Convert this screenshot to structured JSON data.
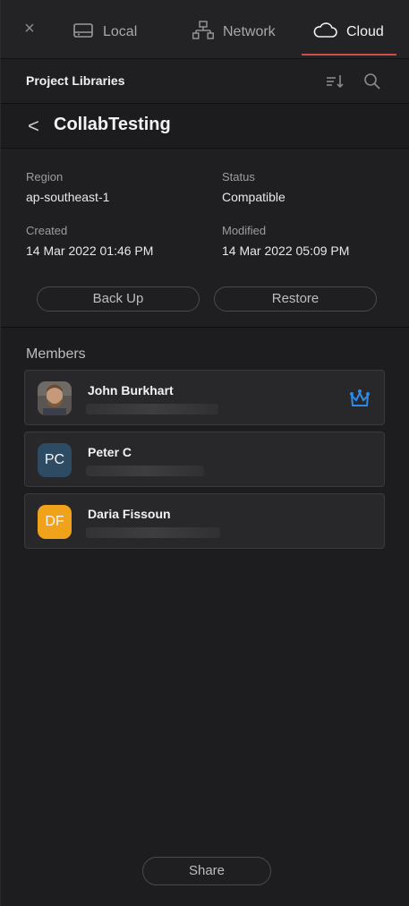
{
  "tabs": {
    "close_label": "×",
    "local": "Local",
    "network": "Network",
    "cloud": "Cloud",
    "active": "Cloud"
  },
  "header": {
    "title": "Project Libraries"
  },
  "project": {
    "name": "CollabTesting",
    "back_label": "<",
    "region_label": "Region",
    "region_value": "ap-southeast-1",
    "status_label": "Status",
    "status_value": "Compatible",
    "created_label": "Created",
    "created_value": "14 Mar 2022 01:46 PM",
    "modified_label": "Modified",
    "modified_value": "14 Mar 2022 05:09 PM",
    "backup_label": "Back Up",
    "restore_label": "Restore"
  },
  "members": {
    "title": "Members",
    "items": [
      {
        "name": "John Burkhart",
        "avatar_type": "photo",
        "owner": true,
        "crown_icon": "crown-icon"
      },
      {
        "name": "Peter C",
        "initials": "PC",
        "avatar_color": "#2e4b64"
      },
      {
        "name": "Daria Fissoun",
        "initials": "DF",
        "avatar_color": "#f0a21a"
      }
    ]
  },
  "share": {
    "label": "Share"
  },
  "colors": {
    "accent_underline": "#d24b4b",
    "crown": "#2d8ae6"
  }
}
